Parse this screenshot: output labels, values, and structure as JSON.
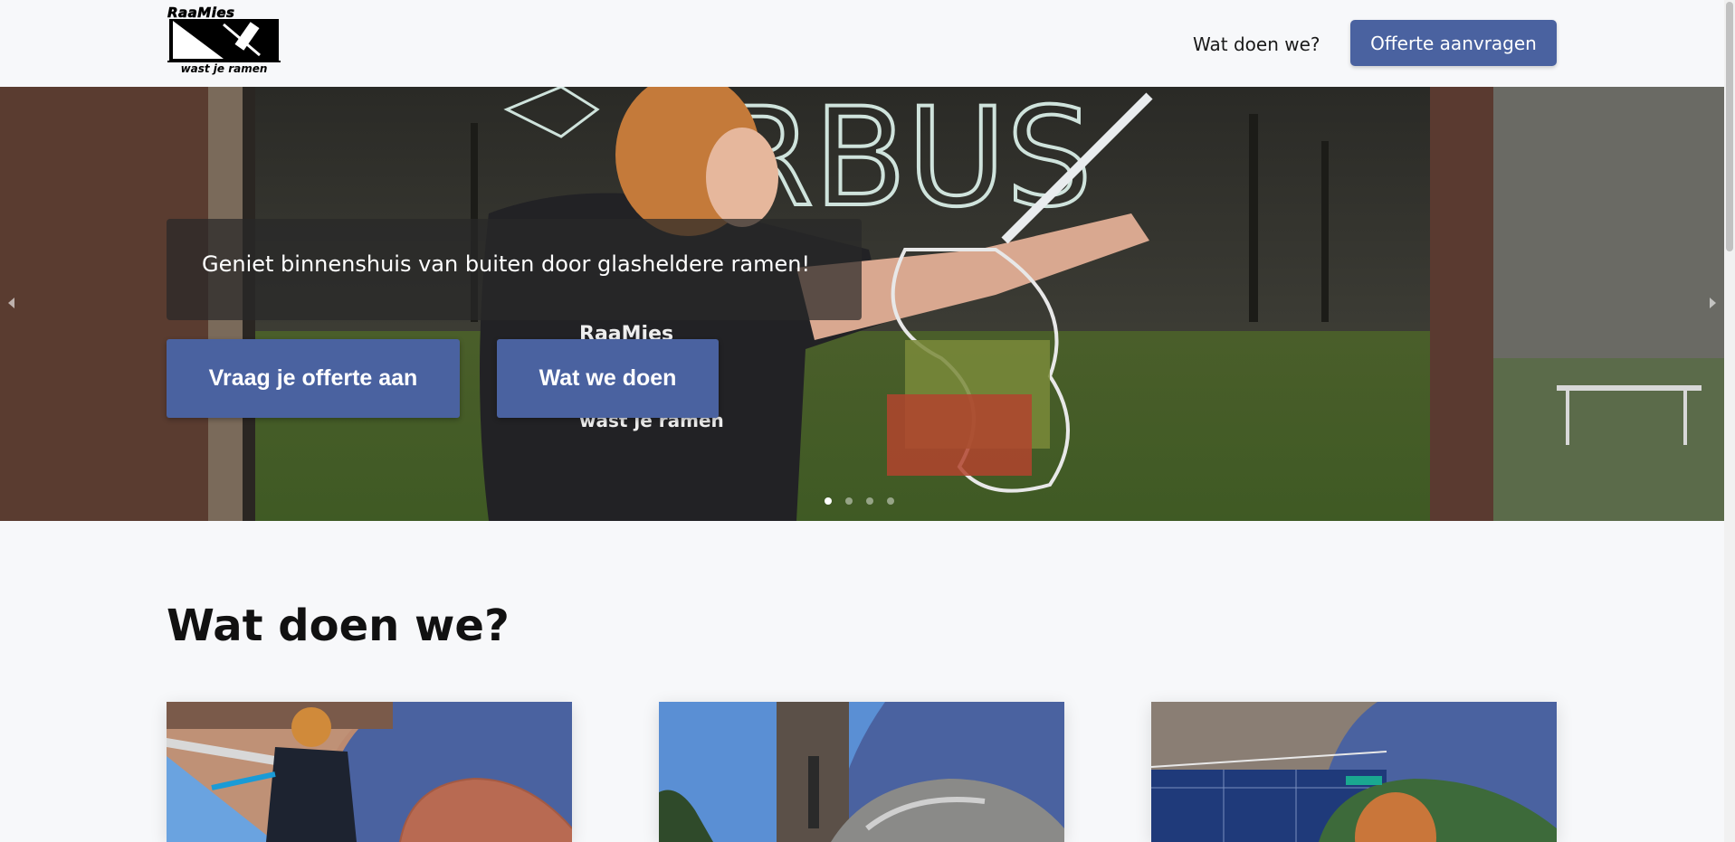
{
  "header": {
    "logo_top": "RaaMies",
    "logo_bottom": "wast je ramen",
    "nav_link": "Wat doen we?",
    "cta_label": "Offerte aanvragen"
  },
  "hero": {
    "caption": "Geniet binnenshuis van buiten door glasheldere ramen!",
    "button_primary": "Vraag je offerte aan",
    "button_secondary": "Wat we doen",
    "slides_total": 4,
    "active_slide": 1,
    "window_lettering": "ERBUS",
    "shirt_lettering_top": "RaaMies",
    "shirt_lettering_bottom": "wast je ramen"
  },
  "section": {
    "title": "Wat doen we?"
  },
  "colors": {
    "brand_blue": "#4a62a0",
    "page_bg": "#f7f8fa"
  }
}
